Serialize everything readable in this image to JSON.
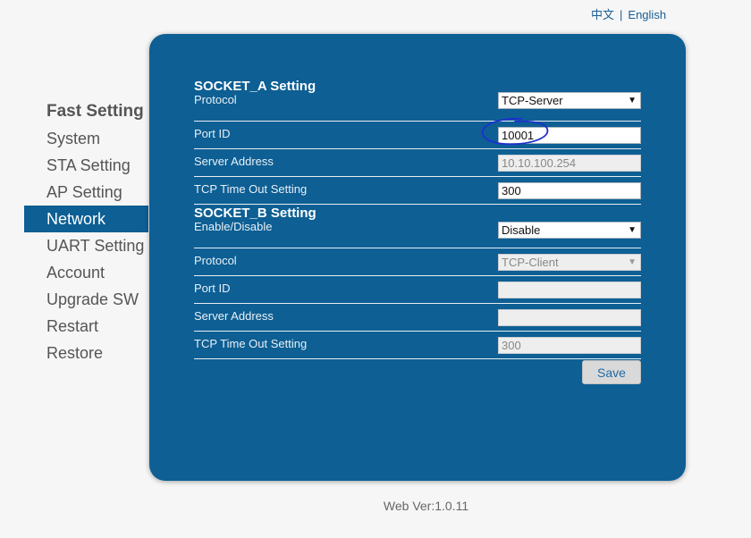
{
  "language": {
    "chinese": "中文",
    "separator": "|",
    "english": "English"
  },
  "sidebar": {
    "title": "Fast Setting",
    "items": [
      {
        "label": "System"
      },
      {
        "label": "STA Setting"
      },
      {
        "label": "AP Setting"
      },
      {
        "label": "Network",
        "active": true
      },
      {
        "label": "UART Setting"
      },
      {
        "label": "Account"
      },
      {
        "label": "Upgrade SW"
      },
      {
        "label": "Restart"
      },
      {
        "label": "Restore"
      }
    ]
  },
  "socket_a": {
    "title": "SOCKET_A Setting",
    "protocol_label": "Protocol",
    "protocol_value": "TCP-Server",
    "port_label": "Port ID",
    "port_value": "10001",
    "server_label": "Server Address",
    "server_value": "10.10.100.254",
    "timeout_label": "TCP Time Out Setting",
    "timeout_value": "300"
  },
  "socket_b": {
    "title": "SOCKET_B Setting",
    "enable_label": "Enable/Disable",
    "enable_value": "Disable",
    "protocol_label": "Protocol",
    "protocol_value": "TCP-Client",
    "port_label": "Port ID",
    "port_value": "",
    "server_label": "Server Address",
    "server_value": "",
    "timeout_label": "TCP Time Out Setting",
    "timeout_value": "300"
  },
  "save_label": "Save",
  "version": "Web Ver:1.0.11",
  "colors": {
    "panel": "#0d5f94",
    "annotation": "#1e2fd0"
  },
  "icons": {
    "dropdown": "chevron-down-icon"
  }
}
